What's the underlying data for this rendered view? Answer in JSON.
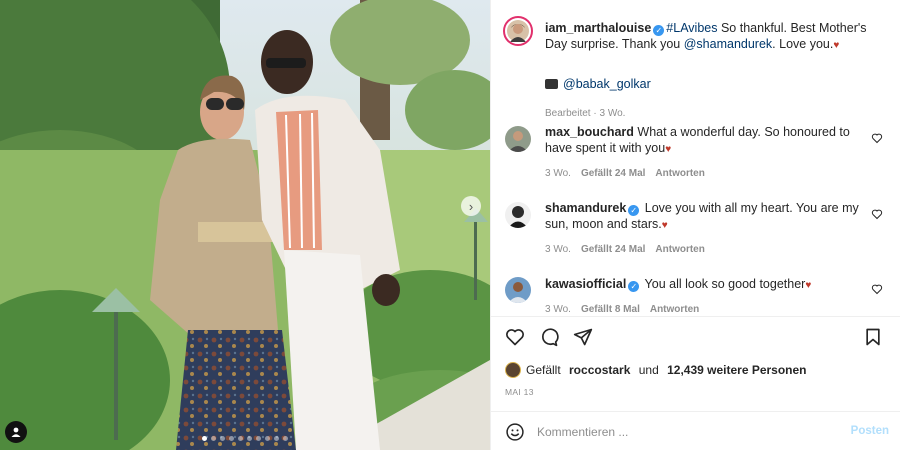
{
  "photo": {
    "next_icon": "chevron-right-icon",
    "tag_icon": "user-tag-icon",
    "carousel_count": 10,
    "carousel_active": 0
  },
  "post": {
    "author": "iam_marthalouise",
    "caption_hashtag": "#LAvibes",
    "caption_text_1": " So thankful. Best Mother's Day surprise. Thank you ",
    "caption_mention": "@shamandurek",
    "caption_text_2": ". Love you.",
    "credit_mention": "@babak_golkar",
    "edited_label": "Bearbeitet · 3 Wo."
  },
  "comments": [
    {
      "username": "max_bouchard",
      "verified": false,
      "text": "What a wonderful day. So honoured to have spent it with you",
      "age": "3 Wo.",
      "likes": "Gefällt 24 Mal",
      "reply": "Antworten"
    },
    {
      "username": "shamandurek",
      "verified": true,
      "text": "Love you with all my heart. You are my sun, moon and stars.",
      "age": "3 Wo.",
      "likes": "Gefällt 24 Mal",
      "reply": "Antworten"
    },
    {
      "username": "kawasiofficial",
      "verified": true,
      "text": "You all look so good together",
      "age": "3 Wo.",
      "likes": "Gefällt 8 Mal",
      "reply": "Antworten"
    }
  ],
  "likes": {
    "prefix": "Gefällt ",
    "user": "roccostark",
    "middle": " und ",
    "others": "12,439 weitere Personen"
  },
  "date": "MAI 13",
  "comment_box": {
    "placeholder": "Kommentieren ...",
    "post_label": "Posten"
  },
  "colors": {
    "verified": "#3897f0",
    "link": "#00376b",
    "muted": "#8e8e8e",
    "post_button_disabled": "#b2dffc"
  }
}
